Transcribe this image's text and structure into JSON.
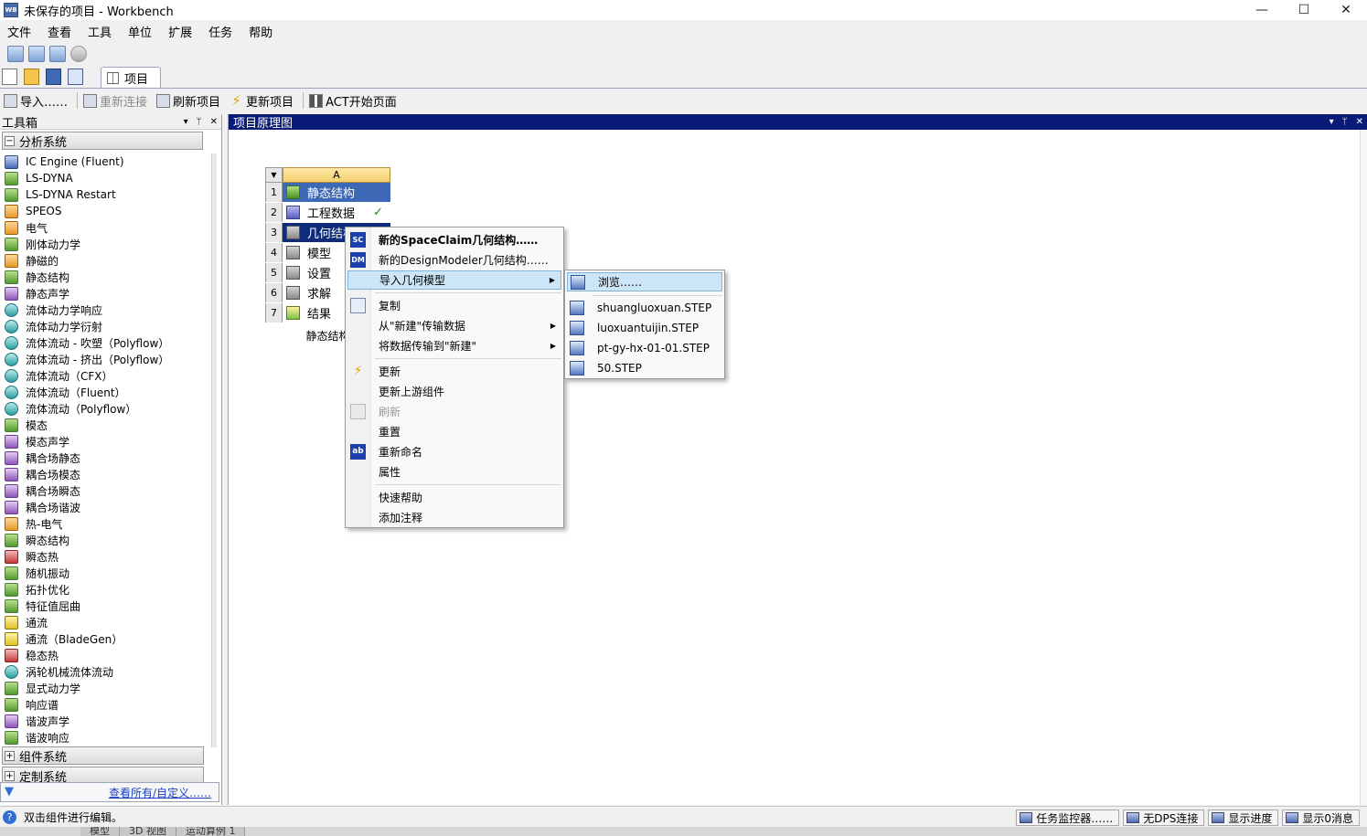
{
  "window": {
    "title": "未保存的项目 - Workbench",
    "app_icon": "WB",
    "controls": [
      "—",
      "☐",
      "✕"
    ]
  },
  "menu": [
    "文件",
    "查看",
    "工具",
    "单位",
    "扩展",
    "任务",
    "帮助"
  ],
  "tabs": {
    "project_tab": "项目"
  },
  "toolbar": {
    "import": "导入……",
    "reconnect": "重新连接",
    "refresh_project": "刷新项目",
    "update_project": "更新项目",
    "act_start": "ACT开始页面"
  },
  "toolbox": {
    "title": "工具箱",
    "pane_controls": [
      "▾",
      "ᛘ",
      "✕"
    ],
    "group_analysis": "分析系统",
    "items": [
      {
        "label": "IC Engine (Fluent)",
        "icon": "blue"
      },
      {
        "label": "LS-DYNA",
        "icon": "green"
      },
      {
        "label": "LS-DYNA Restart",
        "icon": "green"
      },
      {
        "label": "SPEOS",
        "icon": "orange"
      },
      {
        "label": "电气",
        "icon": "orange"
      },
      {
        "label": "刚体动力学",
        "icon": "green"
      },
      {
        "label": "静磁的",
        "icon": "orange"
      },
      {
        "label": "静态结构",
        "icon": "green"
      },
      {
        "label": "静态声学",
        "icon": "purple"
      },
      {
        "label": "流体动力学响应",
        "icon": "teal"
      },
      {
        "label": "流体动力学衍射",
        "icon": "teal"
      },
      {
        "label": "流体流动 - 吹塑（Polyflow）",
        "icon": "teal"
      },
      {
        "label": "流体流动 - 挤出（Polyflow）",
        "icon": "teal"
      },
      {
        "label": "流体流动（CFX）",
        "icon": "teal"
      },
      {
        "label": "流体流动（Fluent）",
        "icon": "teal"
      },
      {
        "label": "流体流动（Polyflow）",
        "icon": "teal"
      },
      {
        "label": "模态",
        "icon": "green"
      },
      {
        "label": "模态声学",
        "icon": "purple"
      },
      {
        "label": "耦合场静态",
        "icon": "purple"
      },
      {
        "label": "耦合场模态",
        "icon": "purple"
      },
      {
        "label": "耦合场瞬态",
        "icon": "purple"
      },
      {
        "label": "耦合场谐波",
        "icon": "purple"
      },
      {
        "label": "热-电气",
        "icon": "orange"
      },
      {
        "label": "瞬态结构",
        "icon": "green"
      },
      {
        "label": "瞬态热",
        "icon": "red"
      },
      {
        "label": "随机振动",
        "icon": "green"
      },
      {
        "label": "拓扑优化",
        "icon": "green"
      },
      {
        "label": "特征值屈曲",
        "icon": "green"
      },
      {
        "label": "通流",
        "icon": "yellow"
      },
      {
        "label": "通流（BladeGen）",
        "icon": "yellow"
      },
      {
        "label": "稳态热",
        "icon": "red"
      },
      {
        "label": "涡轮机械流体流动",
        "icon": "teal"
      },
      {
        "label": "显式动力学",
        "icon": "green"
      },
      {
        "label": "响应谱",
        "icon": "green"
      },
      {
        "label": "谐波声学",
        "icon": "purple"
      },
      {
        "label": "谐波响应",
        "icon": "green"
      }
    ],
    "group_component": "组件系统",
    "group_custom": "定制系统",
    "filter_link": "查看所有/自定义……"
  },
  "schematic": {
    "title": "项目原理图",
    "pane_controls": [
      "▾",
      "ᛘ",
      "✕"
    ],
    "system": {
      "column": "A",
      "name": "静态结构",
      "rows": [
        {
          "num": "1",
          "label": "静态结构",
          "icon": "green",
          "status": ""
        },
        {
          "num": "2",
          "label": "工程数据",
          "icon": "book",
          "status": "✓"
        },
        {
          "num": "3",
          "label": "几何结构",
          "icon": "gray",
          "status": ""
        },
        {
          "num": "4",
          "label": "模型",
          "icon": "gray",
          "status": ""
        },
        {
          "num": "5",
          "label": "设置",
          "icon": "gray",
          "status": ""
        },
        {
          "num": "6",
          "label": "求解",
          "icon": "gray",
          "status": ""
        },
        {
          "num": "7",
          "label": "结果",
          "icon": "sun",
          "status": ""
        }
      ]
    }
  },
  "context_menu": {
    "new_spaceclaim": "新的SpaceClaim几何结构……",
    "new_designmodeler": "新的DesignModeler几何结构……",
    "import_geometry": "导入几何模型",
    "copy": "复制",
    "from_new_transfer": "从\"新建\"传输数据",
    "transfer_to_new": "将数据传输到\"新建\"",
    "update": "更新",
    "update_upstream": "更新上游组件",
    "refresh": "刷新",
    "reset": "重置",
    "rename": "重新命名",
    "properties": "属性",
    "quick_help": "快速帮助",
    "add_note": "添加注释",
    "sc_badge": "SC",
    "dm_badge": "DM",
    "rename_badge": "ab"
  },
  "submenu": {
    "browse": "浏览……",
    "files": [
      "shuangluoxuan.STEP",
      "luoxuantuijin.STEP",
      "pt-gy-hx-01-01.STEP",
      "50.STEP"
    ]
  },
  "status": {
    "help_text": "双击组件进行编辑。",
    "task_monitor": "任务监控器……",
    "no_dps": "无DPS连接",
    "show_progress": "显示进度",
    "show_messages": "显示0消息"
  },
  "bottom_tabs": [
    "模型",
    "3D 视图",
    "运动算例 1"
  ]
}
